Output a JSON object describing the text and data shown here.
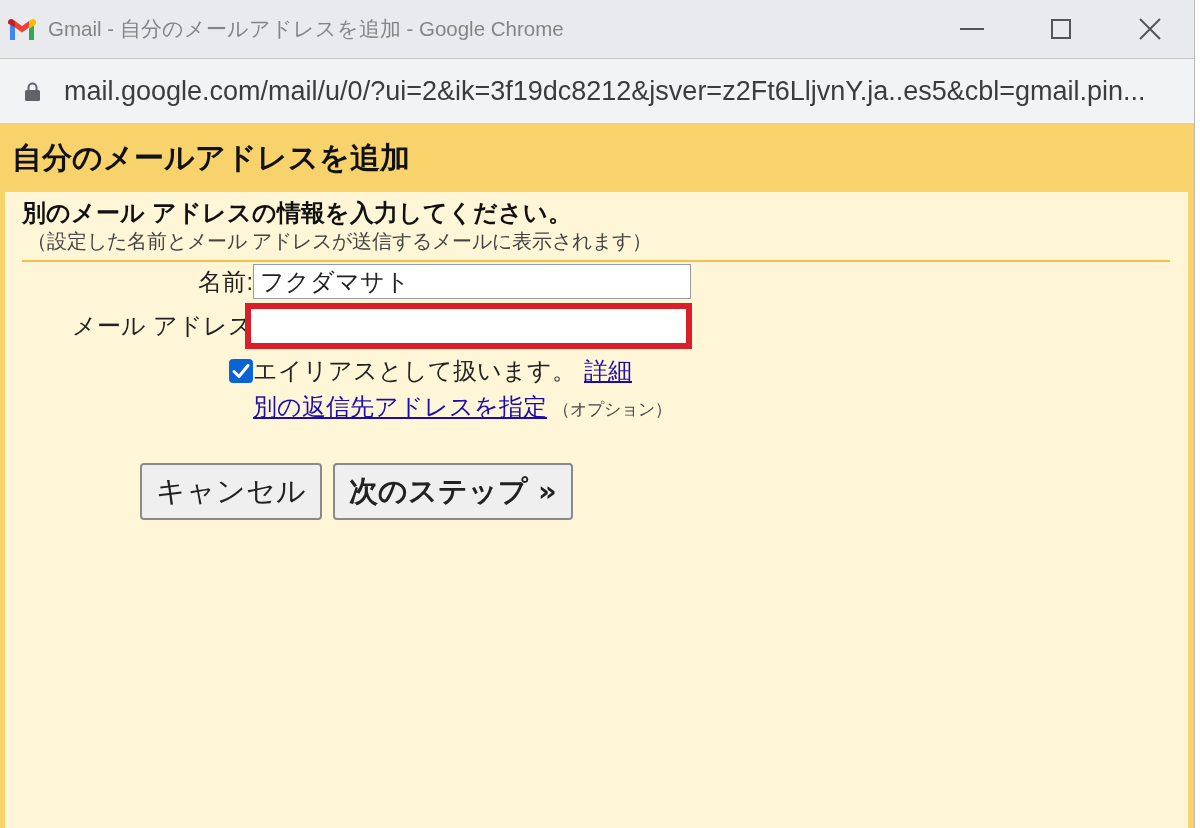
{
  "window": {
    "title": "Gmail - 自分のメールアドレスを追加 - Google Chrome"
  },
  "address_bar": {
    "url": "mail.google.com/mail/u/0/?ui=2&ik=3f19dc8212&jsver=z2Ft6LljvnY.ja..es5&cbl=gmail.pin..."
  },
  "dialog": {
    "title": "自分のメールアドレスを追加",
    "heading": "別のメール アドレスの情報を入力してください。",
    "note": "（設定した名前とメール アドレスが送信するメールに表示されます）",
    "fields": [
      {
        "label": "名前:",
        "value": "フクダマサト",
        "highlighted": false
      },
      {
        "label": "メール アドレス",
        "highlighted": true
      }
    ],
    "alias_option": {
      "label": "エイリアスとして扱います。",
      "checked": true,
      "link": "詳細"
    },
    "reply_to": {
      "link": "別の返信先アドレスを指定",
      "note": "（オプション）"
    },
    "buttons": [
      {
        "label": "キャンセル",
        "primary": false
      },
      {
        "label": "次のステップ »",
        "primary": true
      }
    ]
  }
}
